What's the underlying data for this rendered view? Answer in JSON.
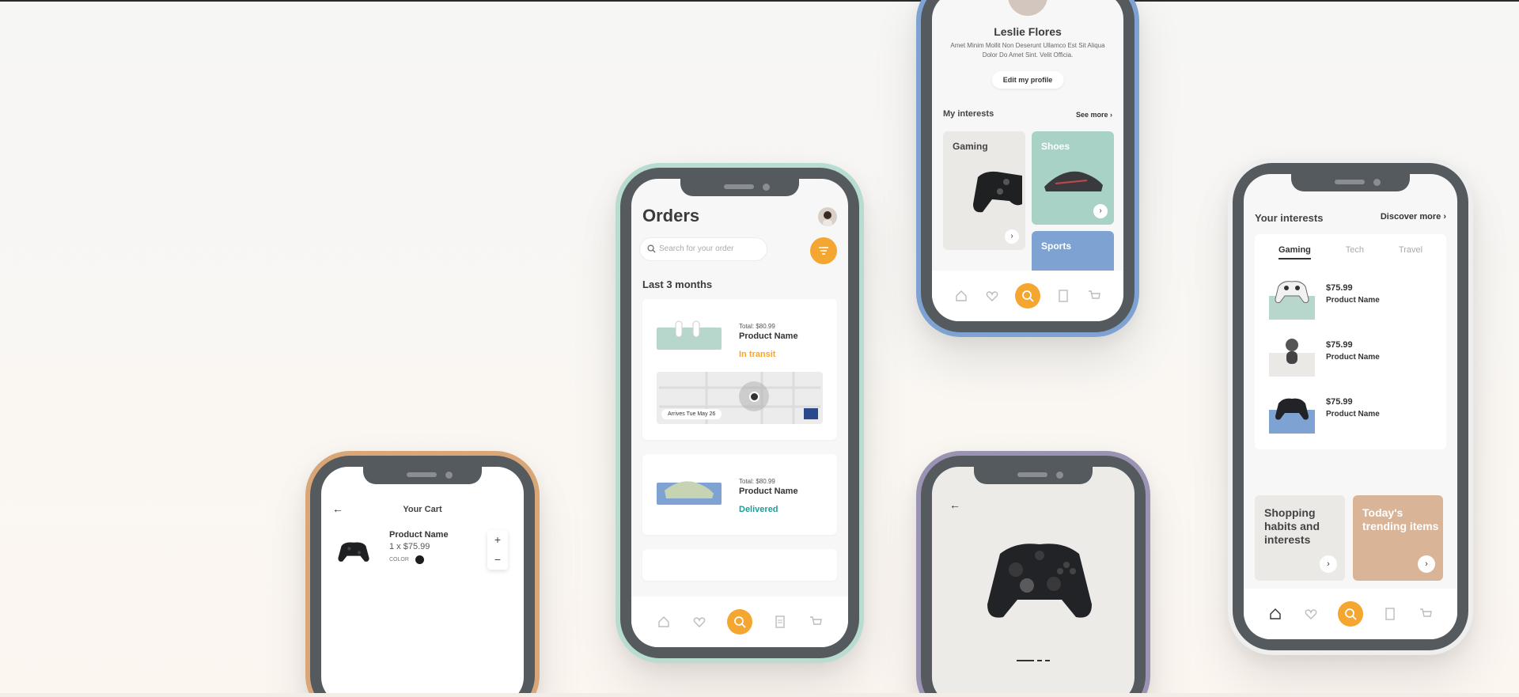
{
  "cart": {
    "title": "Your Cart",
    "back": "←",
    "item": {
      "name": "Product Name",
      "price": "1 x $75.99",
      "color_label": "COLOR",
      "plus": "+",
      "minus": "−"
    }
  },
  "orders": {
    "title": "Orders",
    "search_placeholder": "Search for your order",
    "section": "Last 3 months",
    "cards": [
      {
        "total": "Total: $80.99",
        "name": "Product Name",
        "status": "In transit",
        "status_color": "#f4a630",
        "arrives": "Arrives Tue May 26"
      },
      {
        "total": "Total: $80.99",
        "name": "Product Name",
        "status": "Delivered",
        "status_color": "#1d9c9a"
      }
    ]
  },
  "profile": {
    "name": "Leslie Flores",
    "bio": "Amet Minim Mollit Non Deserunt Ullamco Est Sit Aliqua Dolor Do Amet Sint. Velit Officia.",
    "edit": "Edit my profile",
    "interests_label": "My interests",
    "see_more": "See more",
    "tiles": [
      {
        "label": "Gaming",
        "bg": "#ebe9e6",
        "color": "#444"
      },
      {
        "label": "Shoes",
        "bg": "#a9d2c6",
        "color": "#ffffff"
      },
      {
        "label": "Sports",
        "bg": "#7ea3d2",
        "color": "#ffffff"
      }
    ]
  },
  "product": {
    "back": "←"
  },
  "interests": {
    "title": "Your interests",
    "discover": "Discover more",
    "tabs": [
      "Gaming",
      "Tech",
      "Travel"
    ],
    "items": [
      {
        "price": "$75.99",
        "name": "Product Name",
        "bg": "#b7d7cd"
      },
      {
        "price": "$75.99",
        "name": "Product Name",
        "bg": "#ebe9e6"
      },
      {
        "price": "$75.99",
        "name": "Product Name",
        "bg": "#7ea3d2"
      }
    ],
    "promos": [
      {
        "text": "Shopping habits and interests",
        "bg": "#ebe9e6",
        "color": "#444"
      },
      {
        "text": "Today's trending items",
        "bg": "#d9b497",
        "color": "#ffffff"
      }
    ]
  },
  "colors": {
    "accent": "#f4a630",
    "bezel": "#555a5e"
  }
}
